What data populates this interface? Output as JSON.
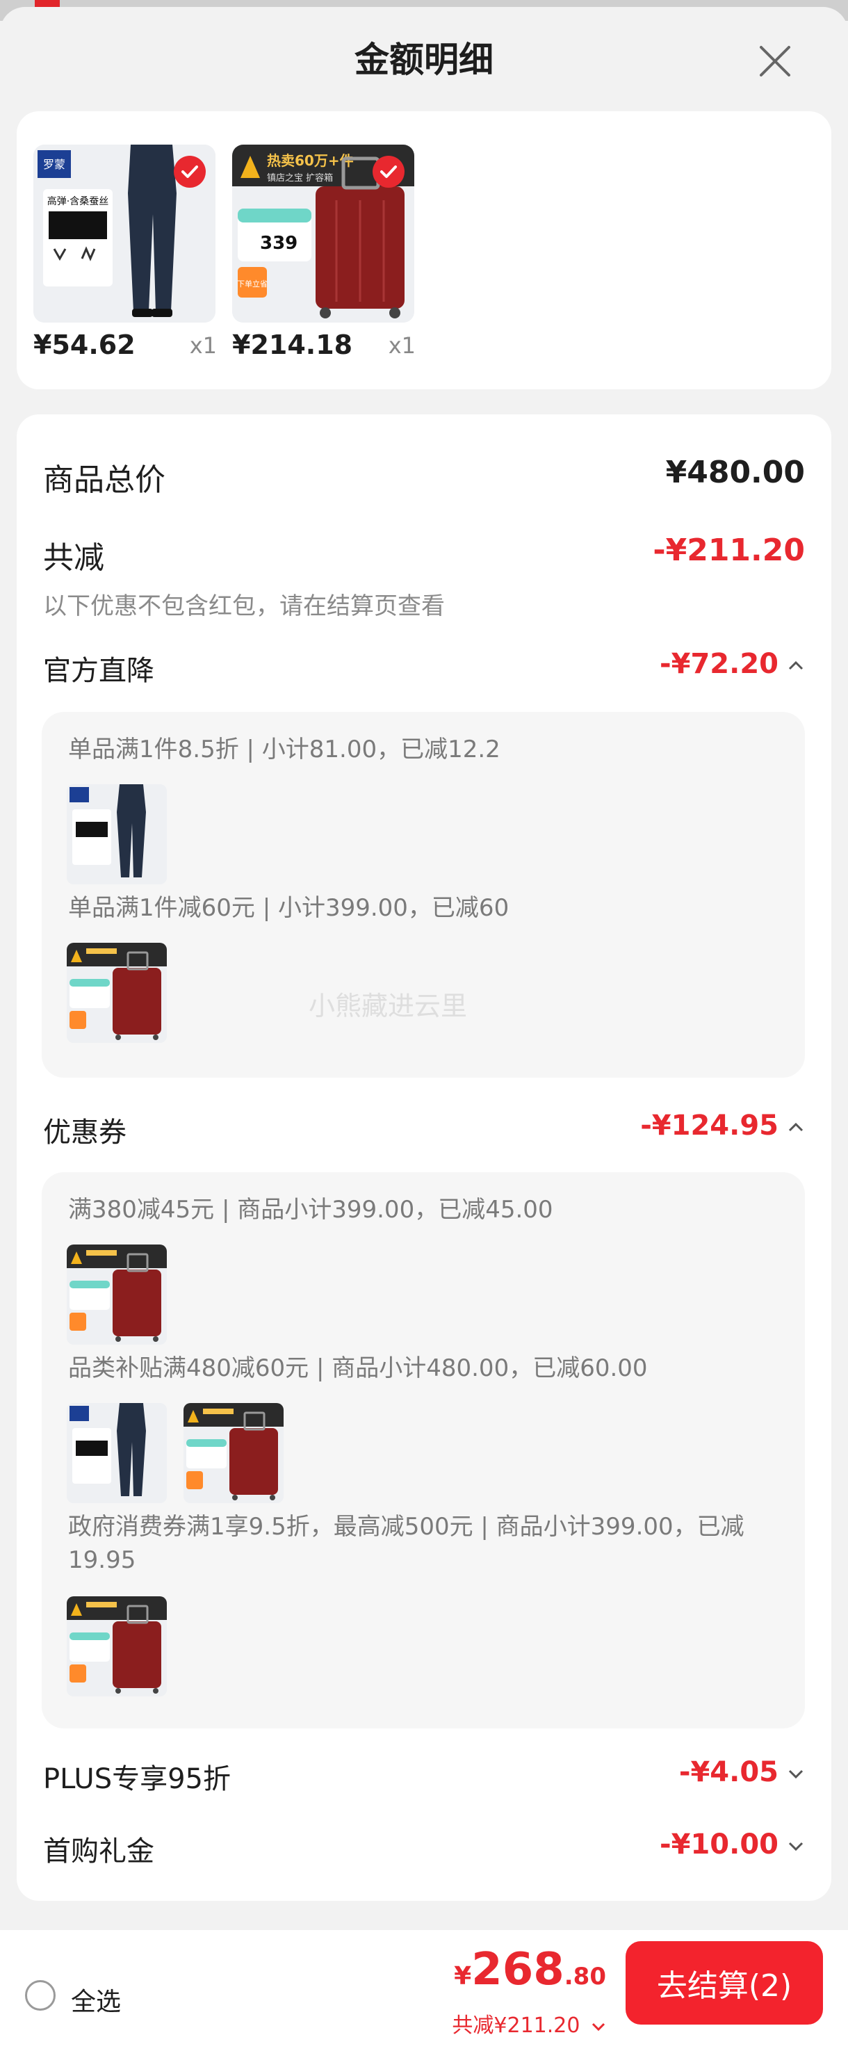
{
  "header": {
    "title": "金额明细"
  },
  "products": [
    {
      "price": "¥54.62",
      "qty": "x1",
      "name": "pants",
      "brand": "罗蒙",
      "tag1": "高弹·含桑蚕丝"
    },
    {
      "price": "¥214.18",
      "qty": "x1",
      "name": "suitcase",
      "banner": "热卖60万+件",
      "sub": "镇店之宝 扩容箱",
      "badge_price": "339",
      "badge_text": "下单立省"
    }
  ],
  "summary": {
    "goods_total_label": "商品总价",
    "goods_total_value": "¥480.00",
    "total_discount_label": "共减",
    "total_discount_value": "-¥211.20",
    "note": "以下优惠不包含红包，请在结算页查看"
  },
  "official": {
    "label": "官方直降",
    "value": "-¥72.20",
    "rules": [
      "单品满1件8.5折 | 小计81.00，已减12.2",
      "单品满1件减60元 | 小计399.00，已减60"
    ]
  },
  "watermark": "小熊藏进云里",
  "coupon": {
    "label": "优惠券",
    "value": "-¥124.95",
    "rules": [
      "满380减45元 | 商品小计399.00，已减45.00",
      "品类补贴满480减60元 | 商品小计480.00，已减60.00",
      "政府消费券满1享9.5折，最高减500元 | 商品小计399.00，已减19.95"
    ]
  },
  "plus": {
    "label": "PLUS专享95折",
    "value": "-¥4.05"
  },
  "first": {
    "label": "首购礼金",
    "value": "-¥10.00"
  },
  "bottom": {
    "select_all": "全选",
    "currency": "¥",
    "total_int": "268",
    "total_dec": ".80",
    "saved": "共减¥211.20",
    "checkout": "去结算(2)"
  },
  "colors": {
    "accent": "#e8282f",
    "checkout_bg": "#f3232d"
  }
}
